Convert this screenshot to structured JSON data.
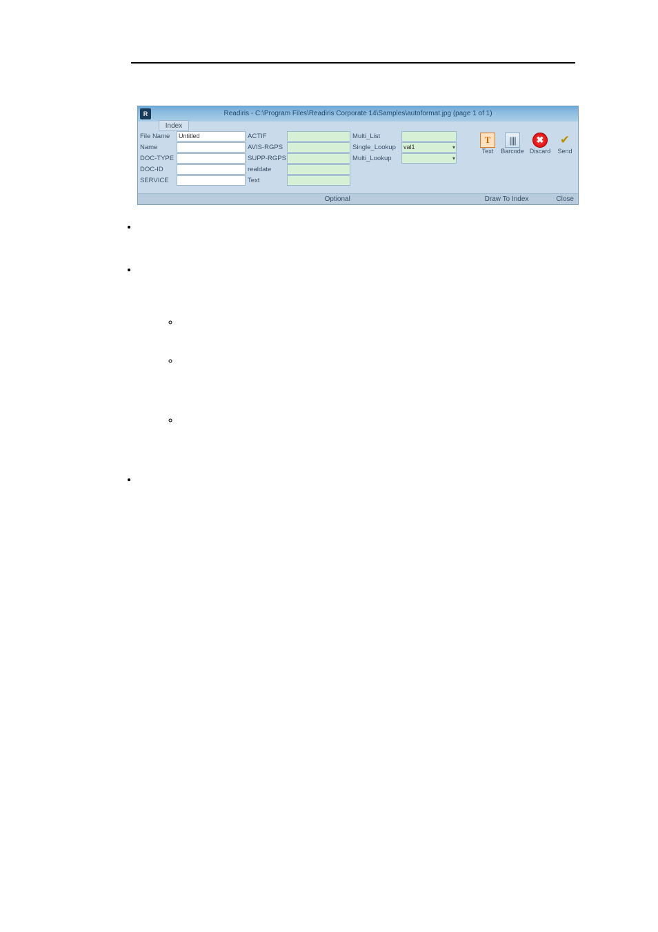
{
  "window_title": "Readiris - C:\\Program Files\\Readiris Corporate 14\\Samples\\autoformat.jpg (page 1 of 1)",
  "tab_label": "Index",
  "col1_labels": [
    "File Name",
    "Name",
    "DOC-TYPE",
    "DOC-ID",
    "SERVICE"
  ],
  "col1_values": [
    "Untitled",
    "",
    "",
    "",
    ""
  ],
  "col2_labels": [
    "ACTIF",
    "AVIS-RGPS",
    "SUPP-RGPS",
    "realdate",
    "Text"
  ],
  "col2_values": [
    "",
    "",
    "",
    "",
    ""
  ],
  "col3_labels": [
    "Multi_List",
    "Single_Lookup",
    "Multi_Lookup"
  ],
  "col3_values": [
    "",
    "val1",
    ""
  ],
  "toolbar": {
    "text": "Text",
    "barcode": "Barcode",
    "discard": "Discard",
    "send": "Send"
  },
  "footer": {
    "optional": "Optional",
    "draw": "Draw To Index",
    "close": "Close"
  },
  "icons": {
    "text_glyph": "T",
    "barcode_glyph": "||||",
    "discard_glyph": "✖",
    "send_glyph": "✔"
  }
}
